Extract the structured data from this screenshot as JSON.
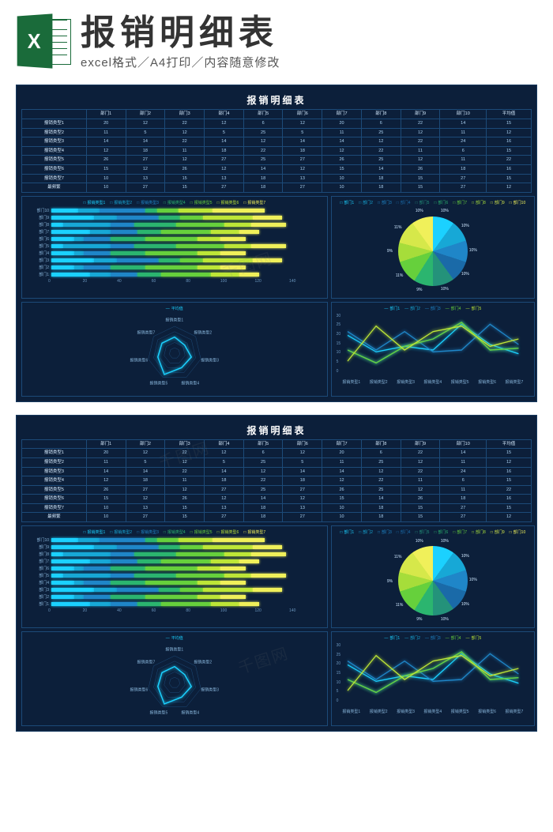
{
  "header": {
    "logo_letter": "X",
    "main_title": "报销明细表",
    "sub_title": "excel格式／A4打印／内容随意修改"
  },
  "dashboard": {
    "title": "报销明细表",
    "columns": [
      "",
      "部门1",
      "部门2",
      "部门3",
      "部门4",
      "部门5",
      "部门6",
      "部门7",
      "部门8",
      "部门9",
      "部门10",
      "平均值"
    ],
    "rows": [
      {
        "label": "报销类型1",
        "values": [
          20,
          12,
          22,
          12,
          6,
          12,
          20,
          6,
          22,
          14,
          15
        ]
      },
      {
        "label": "报销类型2",
        "values": [
          11,
          5,
          12,
          5,
          25,
          5,
          11,
          25,
          12,
          11,
          12
        ]
      },
      {
        "label": "报销类型3",
        "values": [
          14,
          14,
          22,
          14,
          12,
          14,
          14,
          12,
          22,
          24,
          16
        ]
      },
      {
        "label": "报销类型4",
        "values": [
          12,
          18,
          11,
          18,
          22,
          18,
          12,
          22,
          11,
          6,
          15
        ]
      },
      {
        "label": "报销类型5",
        "values": [
          26,
          27,
          12,
          27,
          25,
          27,
          26,
          25,
          12,
          11,
          22
        ]
      },
      {
        "label": "报销类型6",
        "values": [
          15,
          12,
          26,
          12,
          14,
          12,
          15,
          14,
          26,
          18,
          16
        ]
      },
      {
        "label": "报销类型7",
        "values": [
          10,
          13,
          15,
          13,
          18,
          13,
          10,
          18,
          15,
          27,
          15
        ]
      },
      {
        "label": "最频繁",
        "values": [
          10,
          27,
          15,
          27,
          18,
          27,
          10,
          18,
          15,
          27,
          12
        ]
      }
    ]
  },
  "chart_data": [
    {
      "type": "bar",
      "orientation": "horizontal",
      "stacked": true,
      "title": "",
      "categories": [
        "部门1",
        "部门2",
        "部门3",
        "部门4",
        "部门5",
        "部门6",
        "部门7",
        "部门8",
        "部门9",
        "部门10"
      ],
      "series": [
        {
          "name": "报销类型1",
          "color": "#1bd1ff",
          "values": [
            20,
            12,
            22,
            12,
            6,
            12,
            20,
            6,
            22,
            14
          ]
        },
        {
          "name": "报销类型2",
          "color": "#17a8d6",
          "values": [
            11,
            5,
            12,
            5,
            25,
            5,
            11,
            25,
            12,
            11
          ]
        },
        {
          "name": "报销类型3",
          "color": "#1f86c8",
          "values": [
            14,
            14,
            22,
            14,
            12,
            14,
            14,
            12,
            22,
            24
          ]
        },
        {
          "name": "报销类型4",
          "color": "#2bb56f",
          "values": [
            12,
            18,
            11,
            18,
            22,
            18,
            12,
            22,
            11,
            6
          ]
        },
        {
          "name": "报销类型5",
          "color": "#66d03c",
          "values": [
            26,
            27,
            12,
            27,
            25,
            27,
            26,
            25,
            12,
            11
          ]
        },
        {
          "name": "报销类型6",
          "color": "#bde637",
          "values": [
            15,
            12,
            26,
            12,
            14,
            12,
            15,
            14,
            26,
            18
          ]
        },
        {
          "name": "报销类型7",
          "color": "#f0f05a",
          "values": [
            10,
            13,
            15,
            13,
            18,
            13,
            10,
            18,
            15,
            27
          ]
        }
      ],
      "xlim": [
        0,
        140
      ],
      "xticks": [
        0,
        20,
        40,
        60,
        80,
        100,
        120,
        140
      ]
    },
    {
      "type": "pie",
      "title": "",
      "categories": [
        "部门1",
        "部门2",
        "部门3",
        "部门4",
        "部门5",
        "部门6",
        "部门7",
        "部门8",
        "部门9",
        "部门10"
      ],
      "values": [
        10,
        10,
        10,
        10,
        10,
        9,
        11,
        9,
        11,
        10
      ],
      "colors": [
        "#1bd1ff",
        "#17a8d6",
        "#1f86c8",
        "#1a6aa8",
        "#24927a",
        "#2bb56f",
        "#66d03c",
        "#a6dd3a",
        "#d6e84a",
        "#f0f05a"
      ]
    },
    {
      "type": "radar",
      "title": "",
      "categories": [
        "报销类型1",
        "报销类型2",
        "报销类型3",
        "报销类型4",
        "报销类型5",
        "报销类型6",
        "报销类型7"
      ],
      "series": [
        {
          "name": "平均值",
          "color": "#1bd1ff",
          "values": [
            15,
            12,
            16,
            15,
            22,
            16,
            15
          ]
        }
      ],
      "rmax": 25,
      "rticks": [
        5,
        10,
        15,
        20,
        25
      ]
    },
    {
      "type": "line",
      "title": "",
      "categories": [
        "报销类型1",
        "报销类型2",
        "报销类型3",
        "报销类型4",
        "报销类型5",
        "报销类型6",
        "报销类型7"
      ],
      "series": [
        {
          "name": "部门1",
          "color": "#1bd1ff",
          "values": [
            20,
            11,
            14,
            12,
            26,
            15,
            10
          ]
        },
        {
          "name": "部门2",
          "color": "#17a8d6",
          "values": [
            12,
            5,
            14,
            18,
            27,
            12,
            13
          ]
        },
        {
          "name": "部门3",
          "color": "#1f86c8",
          "values": [
            22,
            12,
            22,
            11,
            12,
            26,
            15
          ]
        },
        {
          "name": "部门4",
          "color": "#66d03c",
          "values": [
            12,
            5,
            14,
            18,
            27,
            12,
            13
          ]
        },
        {
          "name": "部门5",
          "color": "#bde637",
          "values": [
            6,
            25,
            12,
            22,
            25,
            14,
            18
          ]
        }
      ],
      "ylim": [
        0,
        30
      ],
      "yticks": [
        0,
        5,
        10,
        15,
        20,
        25,
        30
      ]
    }
  ],
  "watermarks": [
    "千图网",
    "千图网",
    "千图网"
  ]
}
